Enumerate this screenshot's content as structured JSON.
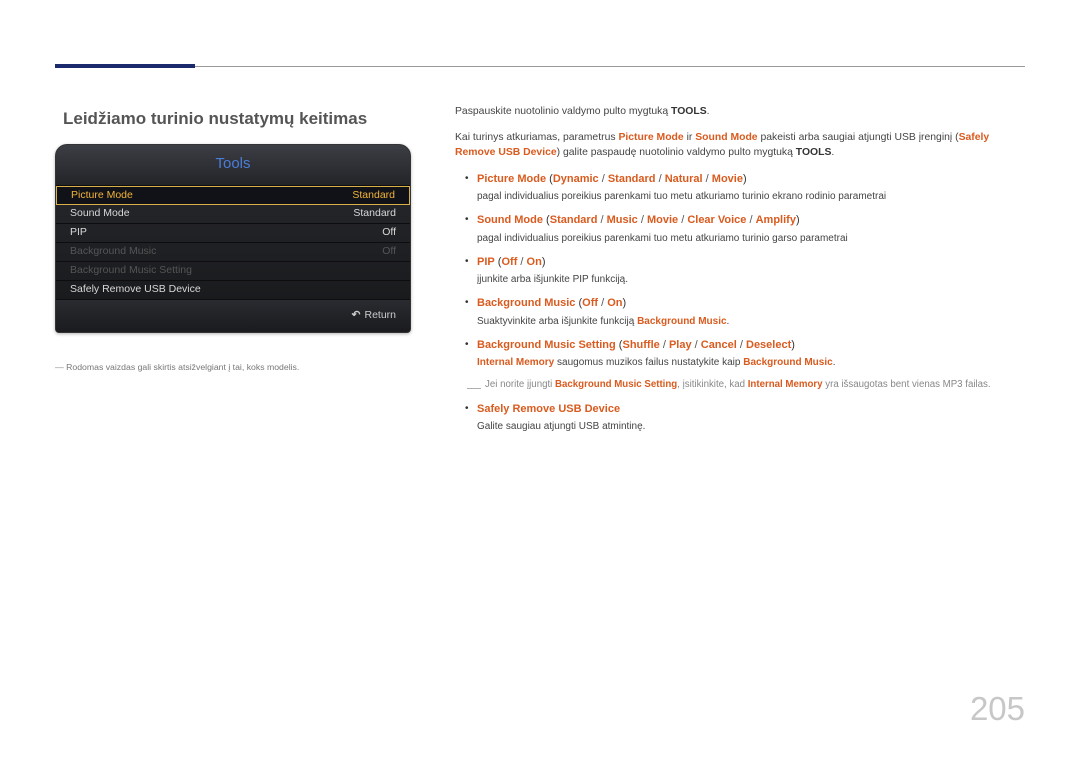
{
  "section_title": "Leidžiamo turinio nustatymų keitimas",
  "screenshot": {
    "title": "Tools",
    "rows": [
      {
        "label": "Picture Mode",
        "value": "Standard",
        "state": "selected"
      },
      {
        "label": "Sound Mode",
        "value": "Standard",
        "state": "normal"
      },
      {
        "label": "PIP",
        "value": "Off",
        "state": "normal"
      },
      {
        "label": "Background Music",
        "value": "Off",
        "state": "disabled"
      },
      {
        "label": "Background Music Setting",
        "value": "",
        "state": "disabled"
      },
      {
        "label": "Safely Remove USB Device",
        "value": "",
        "state": "normal"
      }
    ],
    "footer": {
      "icon": "↶",
      "label": "Return"
    }
  },
  "image_note": "Rodomas vaizdas gali skirtis atsižvelgiant į tai, koks modelis.",
  "intro1": {
    "pre": "Paspauskite nuotolinio valdymo pulto mygtuką ",
    "b1": "TOOLS",
    "post": "."
  },
  "intro2": {
    "t1": "Kai turinys atkuriamas, parametrus ",
    "o1": "Picture Mode",
    "t2": " ir ",
    "o2": "Sound Mode",
    "t3": " pakeisti arba saugiai atjungti USB įrenginį (",
    "o3": "Safely Remove USB Device",
    "t4": ") galite paspaudę nuotolinio valdymo pulto mygtuką ",
    "b1": "TOOLS",
    "t5": "."
  },
  "items": {
    "picture": {
      "name": "Picture Mode",
      "open": " (",
      "o1": "Dynamic",
      "s": " / ",
      "o2": "Standard",
      "o3": "Natural",
      "o4": "Movie",
      "close": ")",
      "desc": "pagal individualius poreikius parenkami tuo metu atkuriamo turinio ekrano rodinio parametrai"
    },
    "sound": {
      "name": "Sound Mode",
      "open": " (",
      "o1": "Standard",
      "s": " / ",
      "o2": "Music",
      "o3": "Movie",
      "o4": "Clear Voice",
      "o5": "Amplify",
      "close": ")",
      "desc": "pagal individualius poreikius parenkami tuo metu atkuriamo turinio garso parametrai"
    },
    "pip": {
      "name": "PIP",
      "open": " (",
      "o1": "Off",
      "s": " / ",
      "o2": "On",
      "close": ")",
      "desc": "įjunkite arba išjunkite PIP funkciją."
    },
    "bgm": {
      "name": "Background Music",
      "open": " (",
      "o1": "Off",
      "s": " / ",
      "o2": "On",
      "close": ")",
      "desc_pre": "Suaktyvinkite arba išjunkite funkciją ",
      "desc_hl": "Background Music",
      "desc_post": "."
    },
    "bgms": {
      "name": "Background Music Setting",
      "open": " (",
      "o1": "Shuffle",
      "s": " / ",
      "o2": "Play",
      "o3": "Cancel",
      "o4": "Deselect",
      "close": ")",
      "desc_hl1": "Internal Memory",
      "desc_mid": " saugomus muzikos failus nustatykite kaip ",
      "desc_hl2": "Background Music",
      "desc_post": "."
    },
    "note": {
      "t1": "Jei norite įjungti ",
      "o1": "Background Music Setting",
      "t2": ", įsitikinkite, kad ",
      "o2": "Internal Memory",
      "t3": " yra išsaugotas bent vienas MP3 failas."
    },
    "safely": {
      "name": "Safely Remove USB Device",
      "desc": "Galite saugiau atjungti USB atmintinę."
    }
  },
  "page_number": "205"
}
